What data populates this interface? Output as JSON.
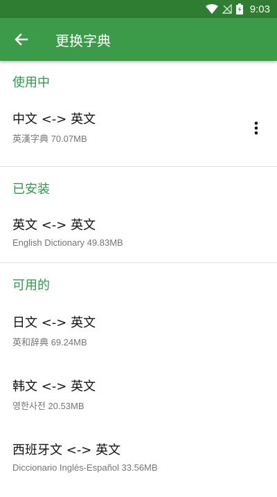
{
  "status_bar": {
    "time": "9:03"
  },
  "app_bar": {
    "title": "更换字典"
  },
  "sections": {
    "in_use": {
      "header": "使用中",
      "items": [
        {
          "title": "中文 <-> 英文",
          "subtitle": "英漢字典 70.07MB"
        }
      ]
    },
    "installed": {
      "header": "已安装",
      "items": [
        {
          "title": "英文 <-> 英文",
          "subtitle": "English Dictionary 49.83MB"
        }
      ]
    },
    "available": {
      "header": "可用的",
      "items": [
        {
          "title": "日文 <-> 英文",
          "subtitle": "英和辞典 69.24MB"
        },
        {
          "title": "韩文 <-> 英文",
          "subtitle": "영한사전 20.53MB"
        },
        {
          "title": "西班牙文 <-> 英文",
          "subtitle": "Diccionario Inglés-Español 33.56MB"
        }
      ]
    }
  },
  "colors": {
    "status_bar": "#2f7d32",
    "app_bar": "#3b9b48",
    "section_header": "#2e9a4a"
  },
  "icons": [
    "wifi-icon",
    "no-signal-icon",
    "battery-charging-icon",
    "back-arrow-icon",
    "more-vert-icon"
  ]
}
